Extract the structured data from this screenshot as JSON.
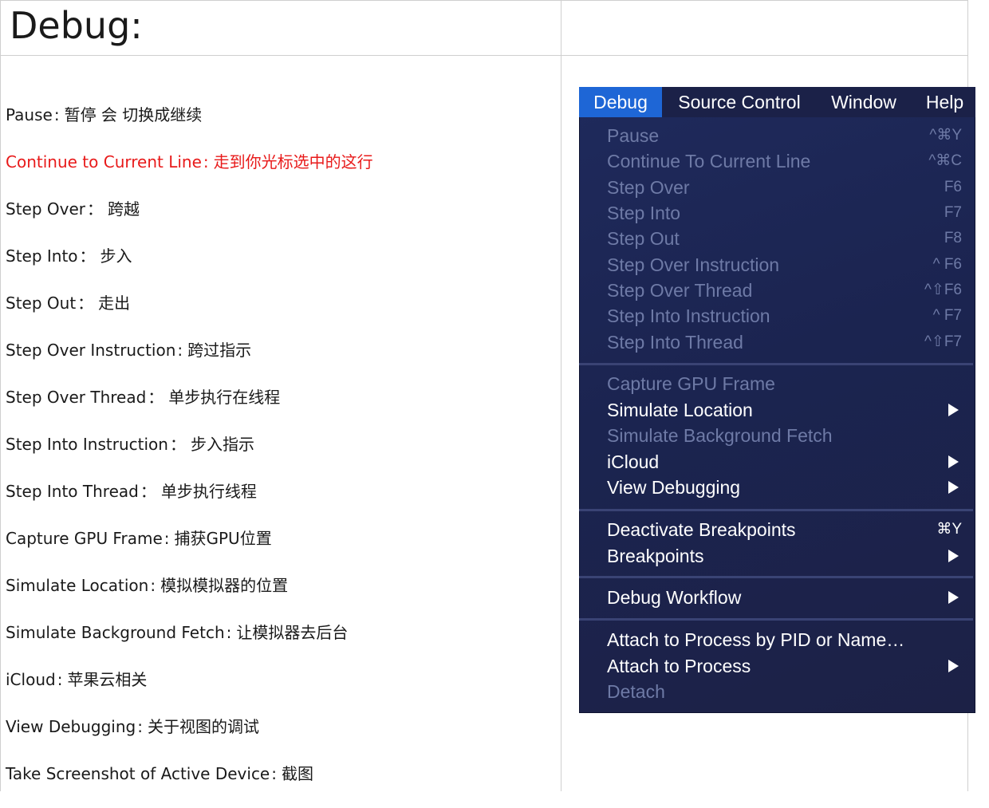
{
  "page": {
    "title": "Debug:"
  },
  "notes": [
    {
      "term": "Pause",
      "sep": ":",
      "desc": "暂停 会 切换成继续",
      "highlight": false
    },
    {
      "term": "Continue to Current Line",
      "sep": ":",
      "desc": "走到你光标选中的这行",
      "highlight": true
    },
    {
      "term": "Step Over",
      "sep": "：",
      "desc": "跨越",
      "highlight": false
    },
    {
      "term": "Step Into",
      "sep": "：",
      "desc": "步入",
      "highlight": false
    },
    {
      "term": "Step Out",
      "sep": "：",
      "desc": "走出",
      "highlight": false
    },
    {
      "term": "Step Over Instruction",
      "sep": ":",
      "desc": "跨过指示",
      "highlight": false
    },
    {
      "term": "Step Over Thread",
      "sep": "：",
      "desc": "单步执行在线程",
      "highlight": false
    },
    {
      "term": "Step Into Instruction",
      "sep": "：",
      "desc": "步入指示",
      "highlight": false
    },
    {
      "term": "Step Into Thread",
      "sep": "：",
      "desc": "单步执行线程",
      "highlight": false
    },
    {
      "term": "Capture GPU Frame",
      "sep": ":",
      "desc": "捕获GPU位置",
      "highlight": false
    },
    {
      "term": "Simulate Location",
      "sep": ":",
      "desc": "模拟模拟器的位置",
      "highlight": false
    },
    {
      "term": "Simulate Background Fetch",
      "sep": ":",
      "desc": "让模拟器去后台",
      "highlight": false
    },
    {
      "term": "iCloud",
      "sep": ":",
      "desc": "苹果云相关",
      "highlight": false
    },
    {
      "term": "View Debugging",
      "sep": ":",
      "desc": "关于视图的调试",
      "highlight": false
    },
    {
      "term": "Take Screenshot of Active Device",
      "sep": ":",
      "desc": "截图",
      "highlight": false
    }
  ],
  "menubar": {
    "items": [
      "Debug",
      "Source Control",
      "Window",
      "Help"
    ],
    "active": "Debug"
  },
  "menu": {
    "items": [
      {
        "label": "Pause",
        "shortcut": "^⌘Y",
        "enabled": false,
        "submenu": false
      },
      {
        "label": "Continue To Current Line",
        "shortcut": "^⌘C",
        "enabled": false,
        "submenu": false
      },
      {
        "label": "Step Over",
        "shortcut": "F6",
        "enabled": false,
        "submenu": false
      },
      {
        "label": "Step Into",
        "shortcut": "F7",
        "enabled": false,
        "submenu": false
      },
      {
        "label": "Step Out",
        "shortcut": "F8",
        "enabled": false,
        "submenu": false
      },
      {
        "label": "Step Over Instruction",
        "shortcut": "^ F6",
        "enabled": false,
        "submenu": false
      },
      {
        "label": "Step Over Thread",
        "shortcut": "^⇧F6",
        "enabled": false,
        "submenu": false
      },
      {
        "label": "Step Into Instruction",
        "shortcut": "^ F7",
        "enabled": false,
        "submenu": false
      },
      {
        "label": "Step Into Thread",
        "shortcut": "^⇧F7",
        "enabled": false,
        "submenu": false
      },
      {
        "label": "Capture GPU Frame",
        "shortcut": "",
        "enabled": false,
        "submenu": false
      },
      {
        "label": "Simulate Location",
        "shortcut": "",
        "enabled": true,
        "submenu": true
      },
      {
        "label": "Simulate Background Fetch",
        "shortcut": "",
        "enabled": false,
        "submenu": false
      },
      {
        "label": "iCloud",
        "shortcut": "",
        "enabled": true,
        "submenu": true
      },
      {
        "label": "View Debugging",
        "shortcut": "",
        "enabled": true,
        "submenu": true
      },
      {
        "label": "Deactivate Breakpoints",
        "shortcut": "⌘Y",
        "enabled": true,
        "submenu": false
      },
      {
        "label": "Breakpoints",
        "shortcut": "",
        "enabled": true,
        "submenu": true
      },
      {
        "label": "Debug Workflow",
        "shortcut": "",
        "enabled": true,
        "submenu": true
      },
      {
        "label": "Attach to Process by PID or Name…",
        "shortcut": "",
        "enabled": true,
        "submenu": false
      },
      {
        "label": "Attach to Process",
        "shortcut": "",
        "enabled": true,
        "submenu": true
      },
      {
        "label": "Detach",
        "shortcut": "",
        "enabled": false,
        "submenu": false
      }
    ]
  },
  "colors": {
    "highlight_text": "#e81a1a",
    "menu_active": "#1e66d6",
    "menu_bg": "#1b2450",
    "menu_disabled_text": "#6e7aa6"
  }
}
